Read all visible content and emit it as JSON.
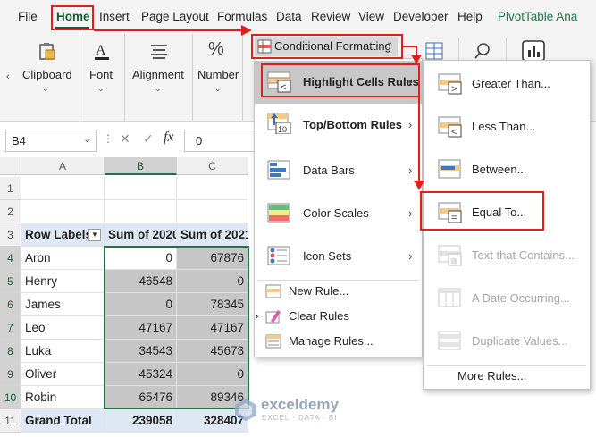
{
  "menubar": {
    "tabs": [
      "File",
      "Home",
      "Insert",
      "Page Layout",
      "Formulas",
      "Data",
      "Review",
      "View",
      "Developer",
      "Help",
      "PivotTable Ana"
    ]
  },
  "ribbon": {
    "clipboard": "Clipboard",
    "font": "Font",
    "alignment": "Alignment",
    "number": "Number",
    "conditional_formatting": "Conditional Formatting"
  },
  "formula_bar": {
    "name_box": "B4",
    "cancel": "✕",
    "enter": "✓",
    "fx": "fx",
    "value": "0"
  },
  "grid": {
    "columns": [
      "A",
      "B",
      "C"
    ],
    "row_numbers": [
      "1",
      "2",
      "3",
      "4",
      "5",
      "6",
      "7",
      "8",
      "9",
      "10",
      "11"
    ],
    "headers": [
      "Row Labels",
      "Sum of 2020",
      "Sum of 2021"
    ],
    "rows": [
      {
        "name": "Aron",
        "y2020": "0",
        "y2021": "67876"
      },
      {
        "name": "Henry",
        "y2020": "46548",
        "y2021": "0"
      },
      {
        "name": "James",
        "y2020": "0",
        "y2021": "78345"
      },
      {
        "name": "Leo",
        "y2020": "47167",
        "y2021": "47167"
      },
      {
        "name": "Luka",
        "y2020": "34543",
        "y2021": "45673"
      },
      {
        "name": "Oliver",
        "y2020": "45324",
        "y2021": "0"
      },
      {
        "name": "Robin",
        "y2020": "65476",
        "y2021": "89346"
      }
    ],
    "total": {
      "name": "Grand Total",
      "y2020": "239058",
      "y2021": "328407"
    }
  },
  "cf_menu": {
    "items": [
      {
        "label": "Highlight Cells Rules",
        "icon": "highlight-cells-icon"
      },
      {
        "label": "Top/Bottom Rules",
        "icon": "top-bottom-icon"
      },
      {
        "label": "Data Bars",
        "icon": "data-bars-icon"
      },
      {
        "label": "Color Scales",
        "icon": "color-scales-icon"
      },
      {
        "label": "Icon Sets",
        "icon": "icon-sets-icon"
      }
    ],
    "small_items": [
      {
        "label": "New Rule...",
        "icon": "new-rule-icon"
      },
      {
        "label": "Clear Rules",
        "icon": "clear-rules-icon"
      },
      {
        "label": "Manage Rules...",
        "icon": "manage-rules-icon"
      }
    ]
  },
  "submenu": {
    "items": [
      {
        "label": "Greater Than...",
        "enabled": true
      },
      {
        "label": "Less Than...",
        "enabled": true
      },
      {
        "label": "Between...",
        "enabled": true
      },
      {
        "label": "Equal To...",
        "enabled": true
      },
      {
        "label": "Text that Contains...",
        "enabled": false
      },
      {
        "label": "A Date Occurring...",
        "enabled": false
      },
      {
        "label": "Duplicate Values...",
        "enabled": false
      }
    ],
    "more": "More Rules..."
  },
  "watermark": {
    "brand": "exceldemy",
    "tagline": "EXCEL · DATA · BI"
  },
  "colors": {
    "accent": "#217346",
    "highlight": "#e0201a",
    "selection_fill": "#c6c6c6",
    "pivot_header": "#dde8f4"
  }
}
